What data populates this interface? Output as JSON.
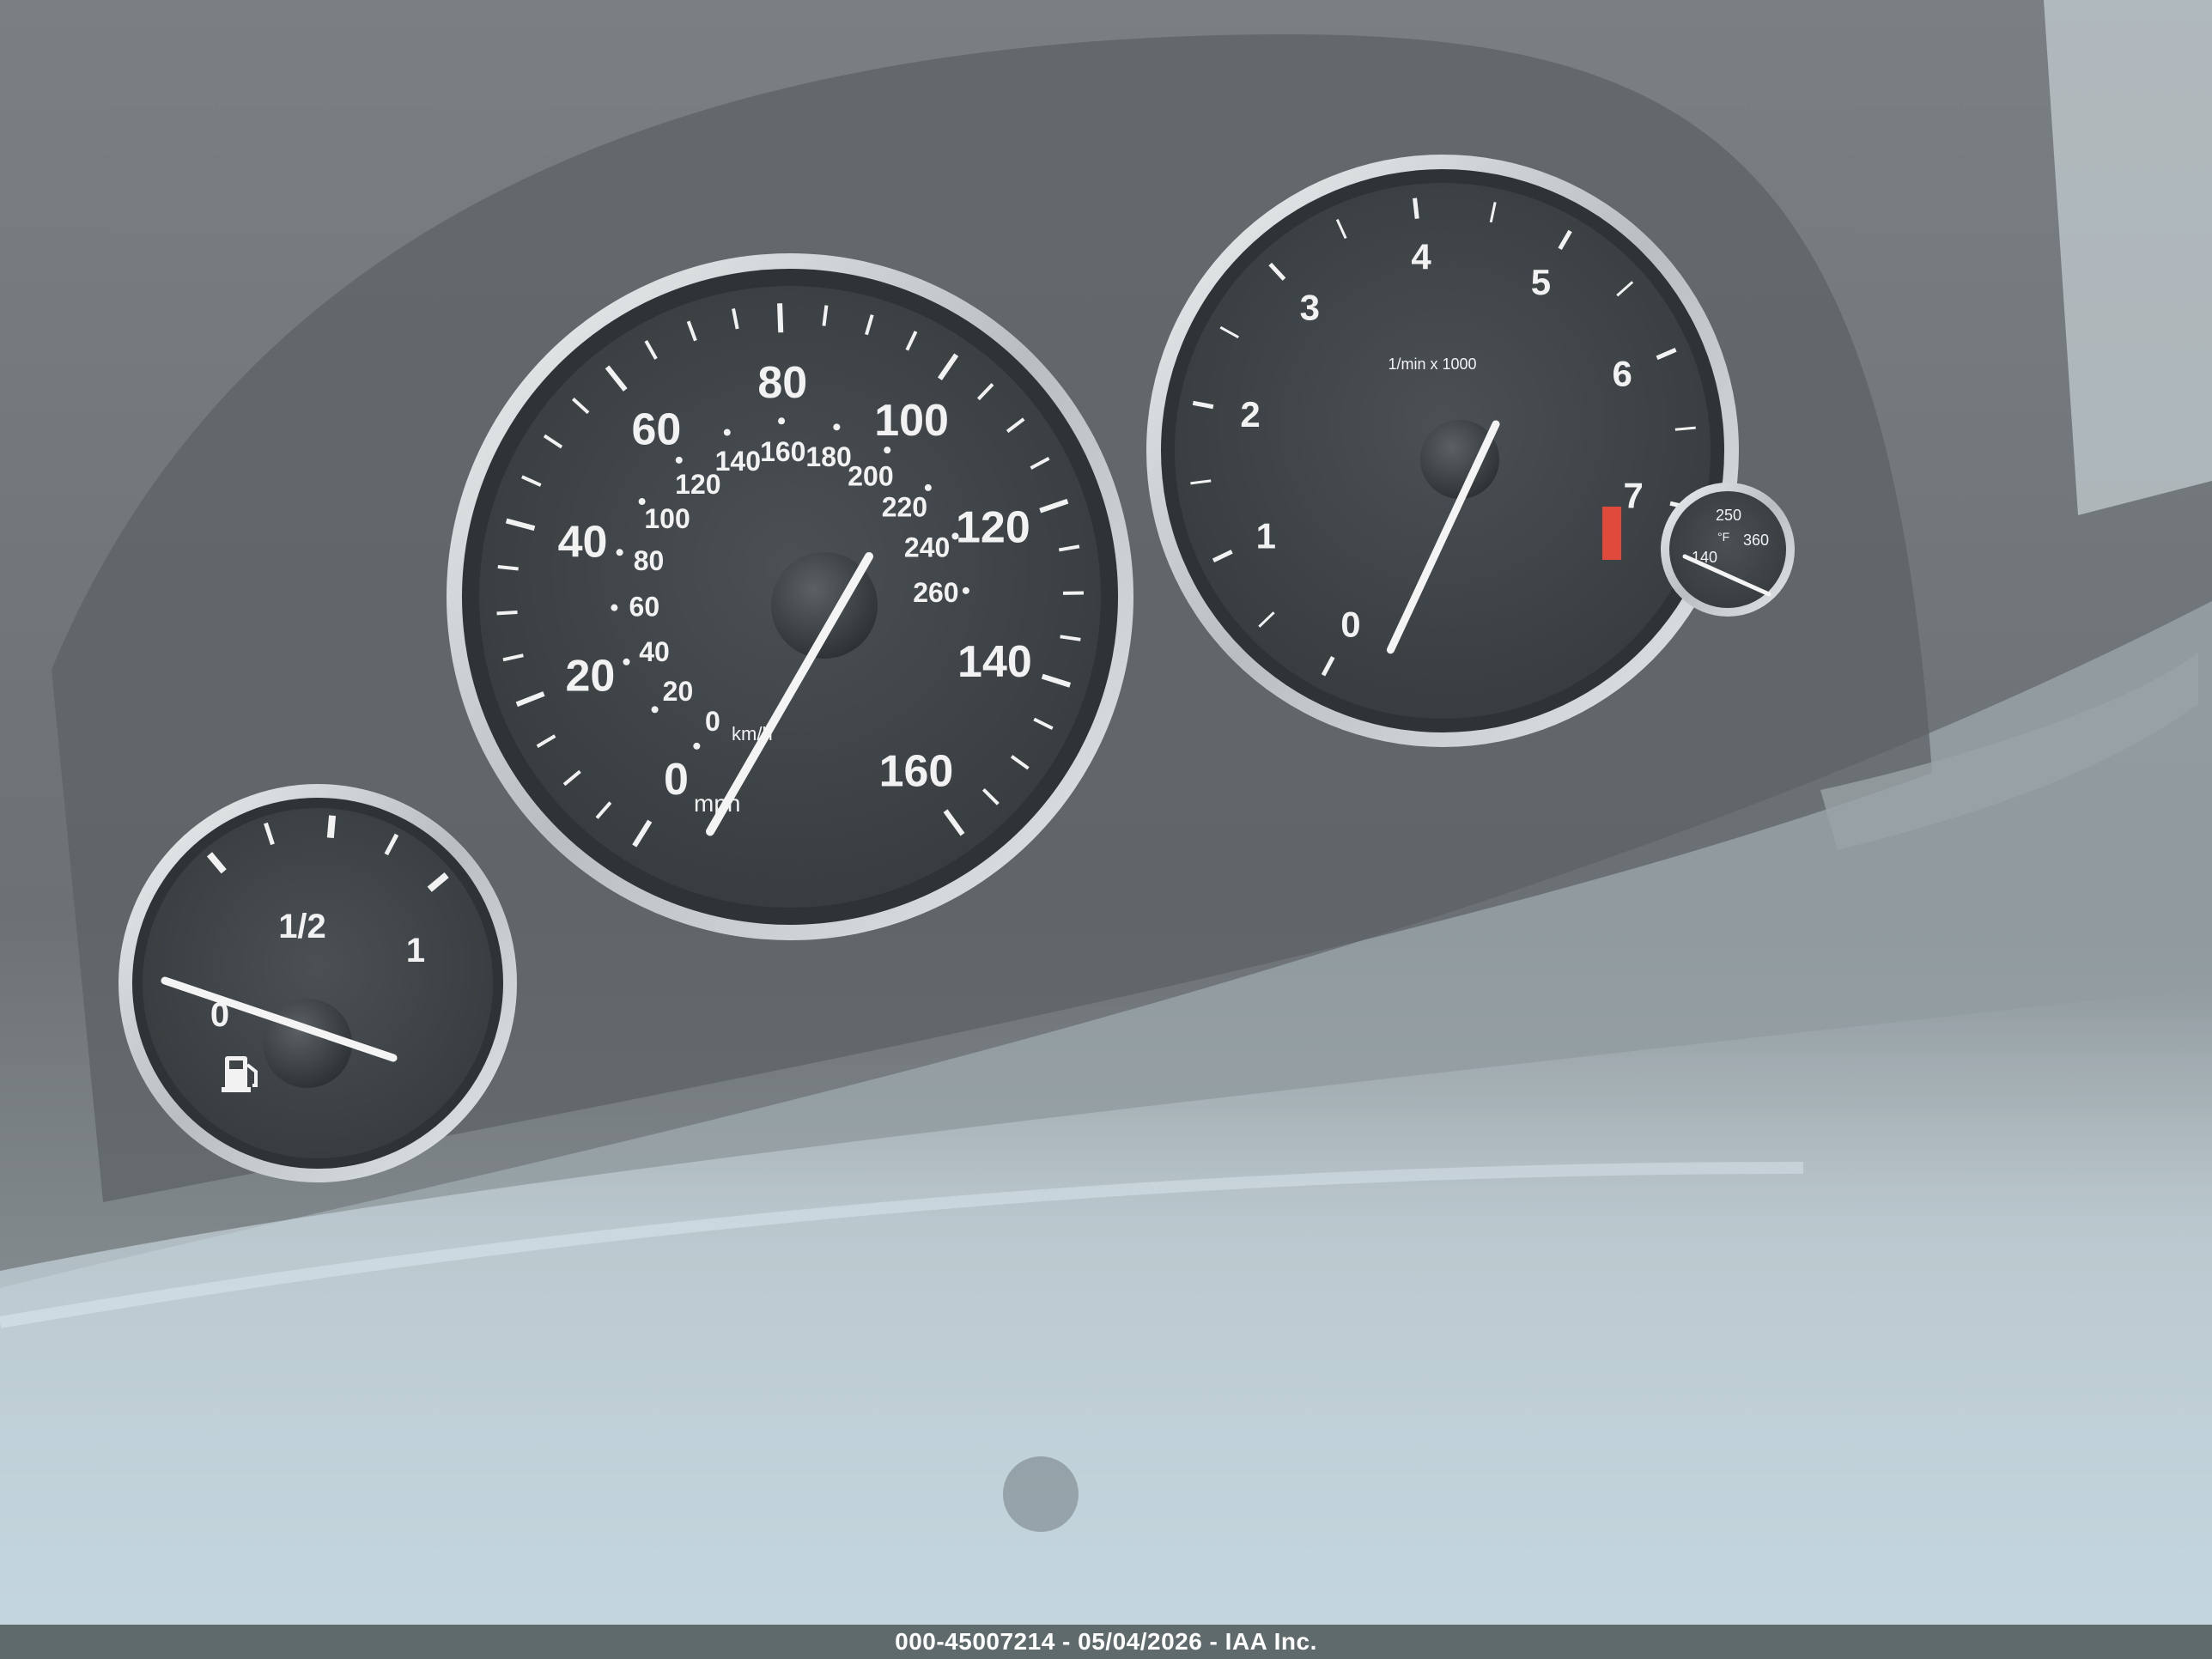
{
  "speedometer": {
    "mph_labels": [
      "0",
      "20",
      "40",
      "60",
      "80",
      "100",
      "120",
      "140",
      "160"
    ],
    "kmh_labels": [
      "0",
      "20",
      "40",
      "60",
      "80",
      "100",
      "120",
      "140",
      "160",
      "180",
      "200",
      "220",
      "240",
      "260"
    ],
    "mph_unit": "mph",
    "kmh_unit": "km/h",
    "reading_mph": 0
  },
  "tachometer": {
    "labels": [
      "0",
      "1",
      "2",
      "3",
      "4",
      "5",
      "6",
      "7"
    ],
    "unit": "1/min x 1000",
    "reading": 0,
    "redline_from": 7
  },
  "fuel_gauge": {
    "labels": [
      "0",
      "1/2",
      "1"
    ],
    "level": 0,
    "icon": "fuel-pump-icon"
  },
  "oil_temp_gauge": {
    "labels": [
      "140",
      "250",
      "360"
    ],
    "unit": "°F"
  },
  "caption": "000-45007214 - 05/04/2026 - IAA Inc.",
  "colors": {
    "dial_face": "#3f4447",
    "ring": "#d8dcde",
    "marking": "#f2f2f2",
    "redline": "#e04a3c"
  }
}
